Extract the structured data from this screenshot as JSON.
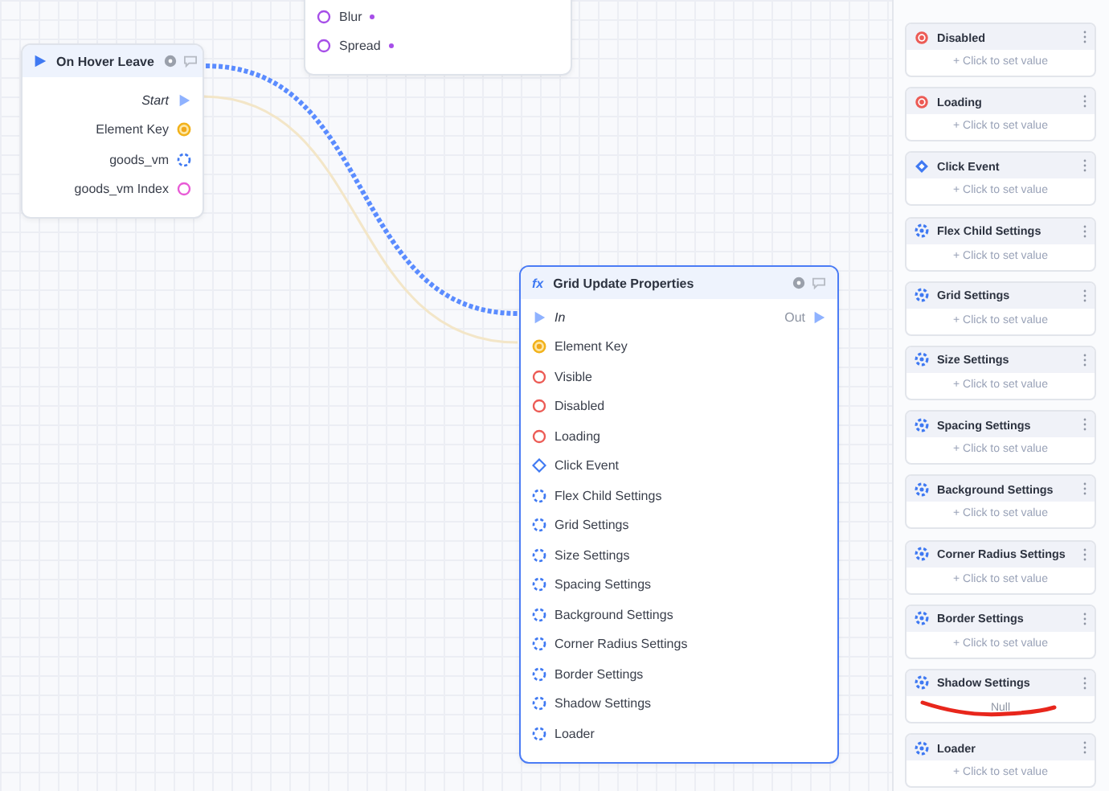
{
  "canvas": {
    "nodes": [
      {
        "kind": "partial",
        "selected": false,
        "ports": [
          {
            "label": "Blur",
            "kind": "number"
          },
          {
            "label": "Spread",
            "kind": "number"
          }
        ]
      },
      {
        "kind": "event",
        "title": "On Hover Leave",
        "selected": false,
        "ports": [
          {
            "label": "Start",
            "kind": "exec"
          },
          {
            "label": "Element Key",
            "kind": "key"
          },
          {
            "label": "goods_vm",
            "kind": "struct"
          },
          {
            "label": "goods_vm Index",
            "kind": "index"
          }
        ]
      },
      {
        "kind": "function",
        "icon_text": "fx",
        "title": "Grid Update Properties",
        "selected": true,
        "in_label": "In",
        "out_label": "Out",
        "ports": [
          {
            "label": "Element Key",
            "kind": "key"
          },
          {
            "label": "Visible",
            "kind": "bool"
          },
          {
            "label": "Disabled",
            "kind": "bool"
          },
          {
            "label": "Loading",
            "kind": "bool"
          },
          {
            "label": "Click Event",
            "kind": "event"
          },
          {
            "label": "Flex Child Settings",
            "kind": "struct"
          },
          {
            "label": "Grid Settings",
            "kind": "struct"
          },
          {
            "label": "Size Settings",
            "kind": "struct"
          },
          {
            "label": "Spacing Settings",
            "kind": "struct"
          },
          {
            "label": "Background Settings",
            "kind": "struct"
          },
          {
            "label": "Corner Radius Settings",
            "kind": "struct"
          },
          {
            "label": "Border Settings",
            "kind": "struct"
          },
          {
            "label": "Shadow Settings",
            "kind": "struct"
          },
          {
            "label": "Loader",
            "kind": "struct"
          }
        ]
      }
    ]
  },
  "properties_panel": {
    "cards": [
      {
        "title": "Disabled",
        "kind": "bool",
        "value": "+ Click to set value",
        "has_value": false
      },
      {
        "title": "Loading",
        "kind": "bool",
        "value": "+ Click to set value",
        "has_value": false
      },
      {
        "title": "Click Event",
        "kind": "event",
        "value": "+ Click to set value",
        "has_value": false
      },
      {
        "title": "Flex Child Settings",
        "kind": "struct",
        "value": "+ Click to set value",
        "has_value": false
      },
      {
        "title": "Grid Settings",
        "kind": "struct",
        "value": "+ Click to set value",
        "has_value": false
      },
      {
        "title": "Size Settings",
        "kind": "struct",
        "value": "+ Click to set value",
        "has_value": false
      },
      {
        "title": "Spacing Settings",
        "kind": "struct",
        "value": "+ Click to set value",
        "has_value": false
      },
      {
        "title": "Background Settings",
        "kind": "struct",
        "value": "+ Click to set value",
        "has_value": false
      },
      {
        "title": "Corner Radius Settings",
        "kind": "struct",
        "value": "+ Click to set value",
        "has_value": false
      },
      {
        "title": "Border Settings",
        "kind": "struct",
        "value": "+ Click to set value",
        "has_value": false
      },
      {
        "title": "Shadow Settings",
        "kind": "struct",
        "value": "Null",
        "has_value": true
      },
      {
        "title": "Loader",
        "kind": "struct",
        "value": "+ Click to set value",
        "has_value": false
      }
    ]
  }
}
